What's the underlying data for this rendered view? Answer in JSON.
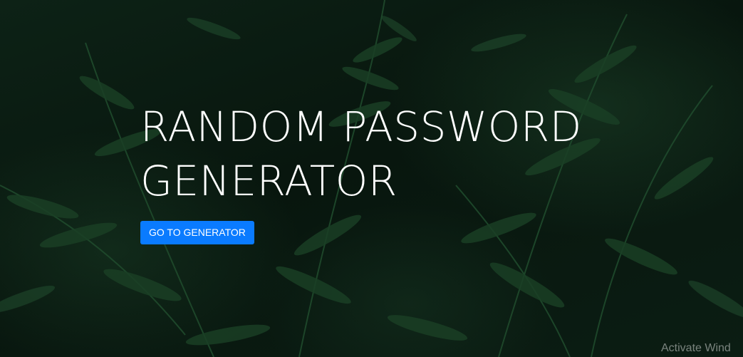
{
  "hero": {
    "title": "RANDOM PASSWORD GENERATOR",
    "cta_label": "GO TO GENERATOR"
  },
  "colors": {
    "button_bg": "#0a7bff",
    "title_text": "#ffffff",
    "background": "#07130c"
  },
  "watermark": {
    "text": "Activate Wind"
  }
}
